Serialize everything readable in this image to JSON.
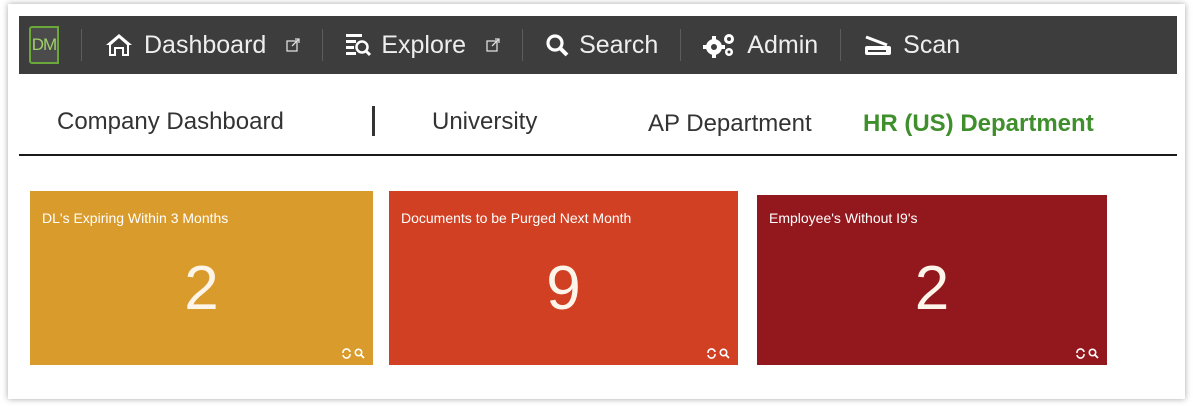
{
  "nav": {
    "logo": "DM",
    "items": [
      {
        "label": "Dashboard"
      },
      {
        "label": "Explore"
      },
      {
        "label": "Search"
      },
      {
        "label": "Admin"
      },
      {
        "label": "Scan"
      }
    ]
  },
  "tabs": [
    {
      "label": "Company Dashboard"
    },
    {
      "label": "University"
    },
    {
      "label": "AP Department"
    },
    {
      "label": "HR (US) Department",
      "active": true
    }
  ],
  "tiles": [
    {
      "title": "DL's Expiring Within 3 Months",
      "value": "2",
      "color": "#d99b2b"
    },
    {
      "title": "Documents to be Purged Next Month",
      "value": "9",
      "color": "#d14023"
    },
    {
      "title": "Employee's Without I9's",
      "value": "2",
      "color": "#93181d"
    }
  ],
  "colors": {
    "nav_bg": "#3d3d3d",
    "active_tab": "#3f8f2d"
  }
}
